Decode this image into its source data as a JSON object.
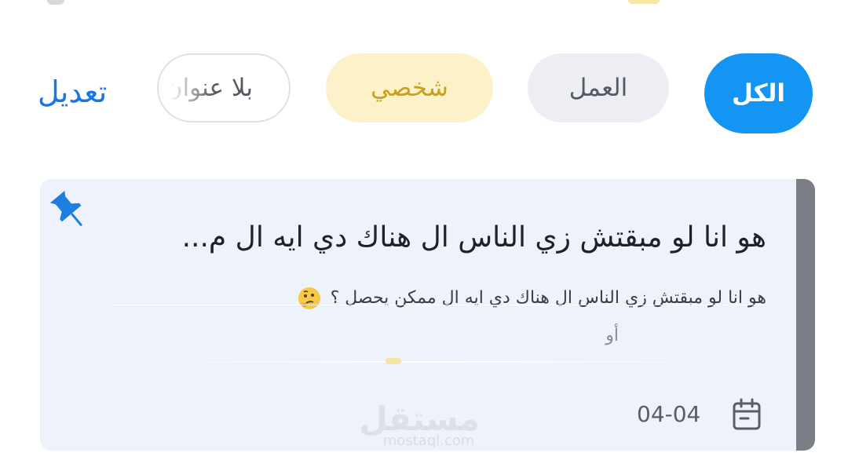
{
  "filters": {
    "all_label": "الكل",
    "work_label": "العمل",
    "personal_label": "شخصي",
    "untitled_label": "بلا عنوان",
    "edit_label": "تعديل"
  },
  "note": {
    "title": "هو انا لو مبقتش زي الناس ال هناك دي ايه ال م...",
    "preview_line1": "هو انا لو مبقتش زي الناس ال هناك دي ايه ال ممكن يحصل ؟",
    "preview_line2": "أو",
    "date": "04-04",
    "emoji": "thinking-face"
  },
  "watermark": {
    "arabic": "مستقل",
    "latin": "mostaql.com"
  },
  "colors": {
    "accent": "#1495f3",
    "personal_bg": "#fdf1c9",
    "personal_text": "#c8a21a",
    "card_bg": "#eef2fa",
    "card_bar": "#7b7e84",
    "link": "#1a73e8"
  }
}
